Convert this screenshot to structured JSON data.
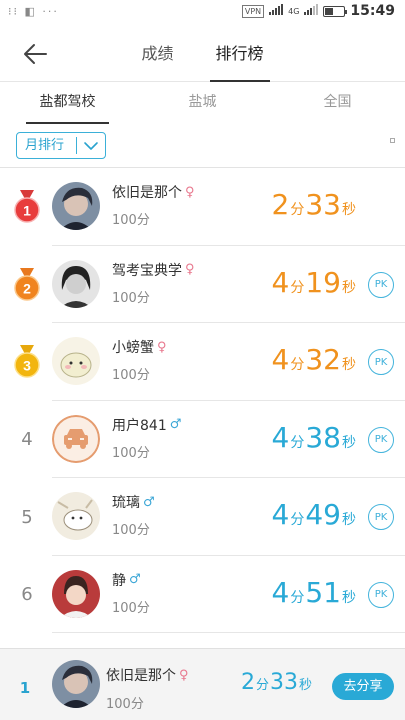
{
  "status_bar": {
    "left_icons": "⁝⁝ ◧ ···",
    "vpn": "VPN",
    "signal_text": "4G",
    "time": "15:49"
  },
  "header": {
    "tabs": [
      {
        "label": "成绩",
        "active": false
      },
      {
        "label": "排行榜",
        "active": true
      }
    ]
  },
  "sub_tabs": [
    {
      "label": "盐都驾校",
      "active": true
    },
    {
      "label": "盐城",
      "active": false
    },
    {
      "label": "全国",
      "active": false
    }
  ],
  "filter": {
    "label": "月排行"
  },
  "rows": [
    {
      "rank": "1",
      "name": "依旧是那个",
      "gender": "♀",
      "score": "100分",
      "min": "2",
      "min_unit": "分",
      "sec": "33",
      "sec_unit": "秒",
      "pk": ""
    },
    {
      "rank": "2",
      "name": "驾考宝典学",
      "gender": "♀",
      "score": "100分",
      "min": "4",
      "min_unit": "分",
      "sec": "19",
      "sec_unit": "秒",
      "pk": "PK"
    },
    {
      "rank": "3",
      "name": "小螃蟹",
      "gender": "♀",
      "score": "100分",
      "min": "4",
      "min_unit": "分",
      "sec": "32",
      "sec_unit": "秒",
      "pk": "PK"
    },
    {
      "rank": "4",
      "name": "用户841",
      "gender": "♂",
      "score": "100分",
      "min": "4",
      "min_unit": "分",
      "sec": "38",
      "sec_unit": "秒",
      "pk": "PK"
    },
    {
      "rank": "5",
      "name": "琉璃",
      "gender": "♂",
      "score": "100分",
      "min": "4",
      "min_unit": "分",
      "sec": "49",
      "sec_unit": "秒",
      "pk": "PK"
    },
    {
      "rank": "6",
      "name": "静",
      "gender": "♂",
      "score": "100分",
      "min": "4",
      "min_unit": "分",
      "sec": "51",
      "sec_unit": "秒",
      "pk": "PK"
    }
  ],
  "my_rank": {
    "rank": "1",
    "name": "依旧是那个",
    "gender": "♀",
    "score": "100分",
    "min": "2",
    "min_unit": "分",
    "sec": "33",
    "sec_unit": "秒",
    "share_label": "去分享"
  },
  "colors": {
    "accent": "#29a9d6",
    "orange": "#f0921e",
    "female": "#e8788e"
  }
}
